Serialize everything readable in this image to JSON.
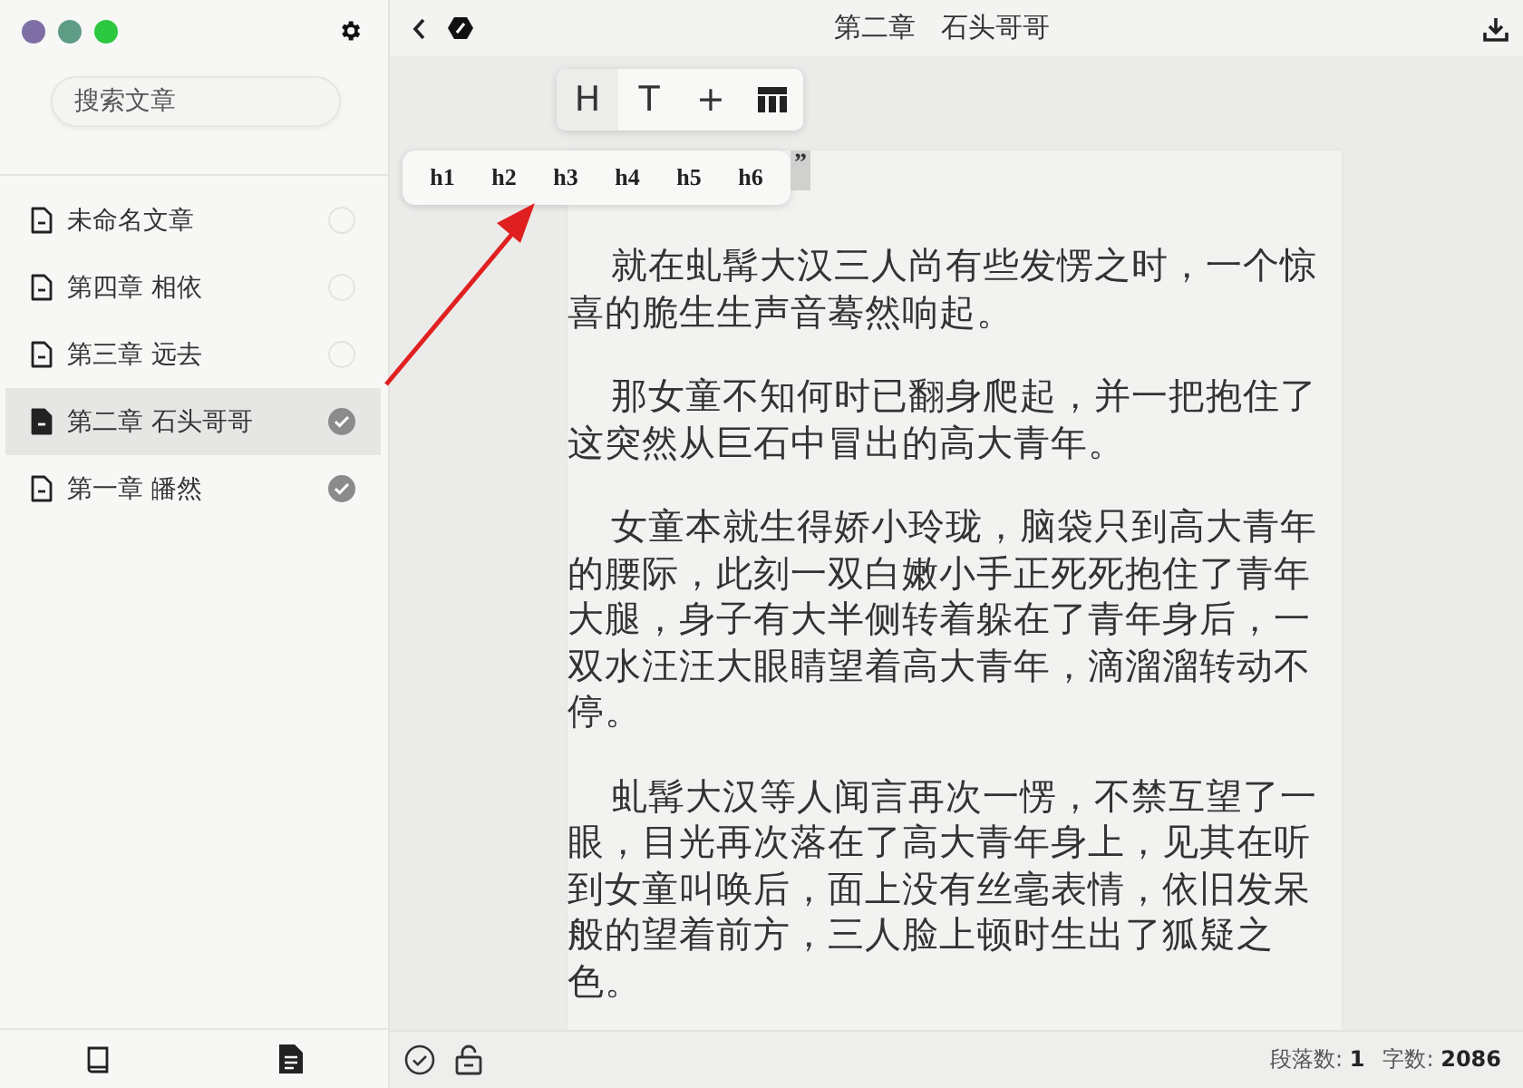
{
  "window": {
    "controls": [
      {
        "color": "#7e6ea6"
      },
      {
        "color": "#5f9c86"
      },
      {
        "color": "#2bc840"
      }
    ]
  },
  "sidebar": {
    "search": {
      "placeholder": "搜索文章"
    },
    "articles": [
      {
        "title": "未命名文章",
        "selected": false,
        "done": false
      },
      {
        "title": "第四章 相依",
        "selected": false,
        "done": false
      },
      {
        "title": "第三章 远去",
        "selected": false,
        "done": false
      },
      {
        "title": "第二章 石头哥哥",
        "selected": true,
        "done": true
      },
      {
        "title": "第一章 皤然",
        "selected": false,
        "done": true
      }
    ]
  },
  "editor": {
    "title": [
      "第二章",
      "石头哥哥"
    ],
    "toolbar": [
      {
        "kind": "text",
        "label": "H",
        "selected": true
      },
      {
        "kind": "text",
        "label": "T",
        "selected": false
      },
      {
        "kind": "text",
        "label": "+",
        "selected": false
      },
      {
        "kind": "table",
        "selected": false
      }
    ],
    "heading_menu": [
      "h1",
      "h2",
      "h3",
      "h4",
      "h5",
      "h6"
    ],
    "quote_mark": "”",
    "paragraphs": [
      "就在虬髯大汉三人尚有些发愣之时，一个惊喜的脆生生声音蓦然响起。",
      "那女童不知何时已翻身爬起，并一把抱住了这突然从巨石中冒出的高大青年。",
      "女童本就生得娇小玲珑，脑袋只到高大青年的腰际，此刻一双白嫩小手正死死抱住了青年大腿，身子有大半侧转着躲在了青年身后，一双水汪汪大眼睛望着高大青年，滴溜溜转动不停。",
      "虬髯大汉等人闻言再次一愣，不禁互望了一眼，目光再次落在了高大青年身上，见其在听到女童叫唤后，面上没有丝毫表情，依旧发呆般的望着前方，三人脸上顿时生出了狐疑之色。"
    ]
  },
  "status_bar": {
    "paragraph_count": "段落数: **1**",
    "word_count": "字数: **2086**"
  }
}
